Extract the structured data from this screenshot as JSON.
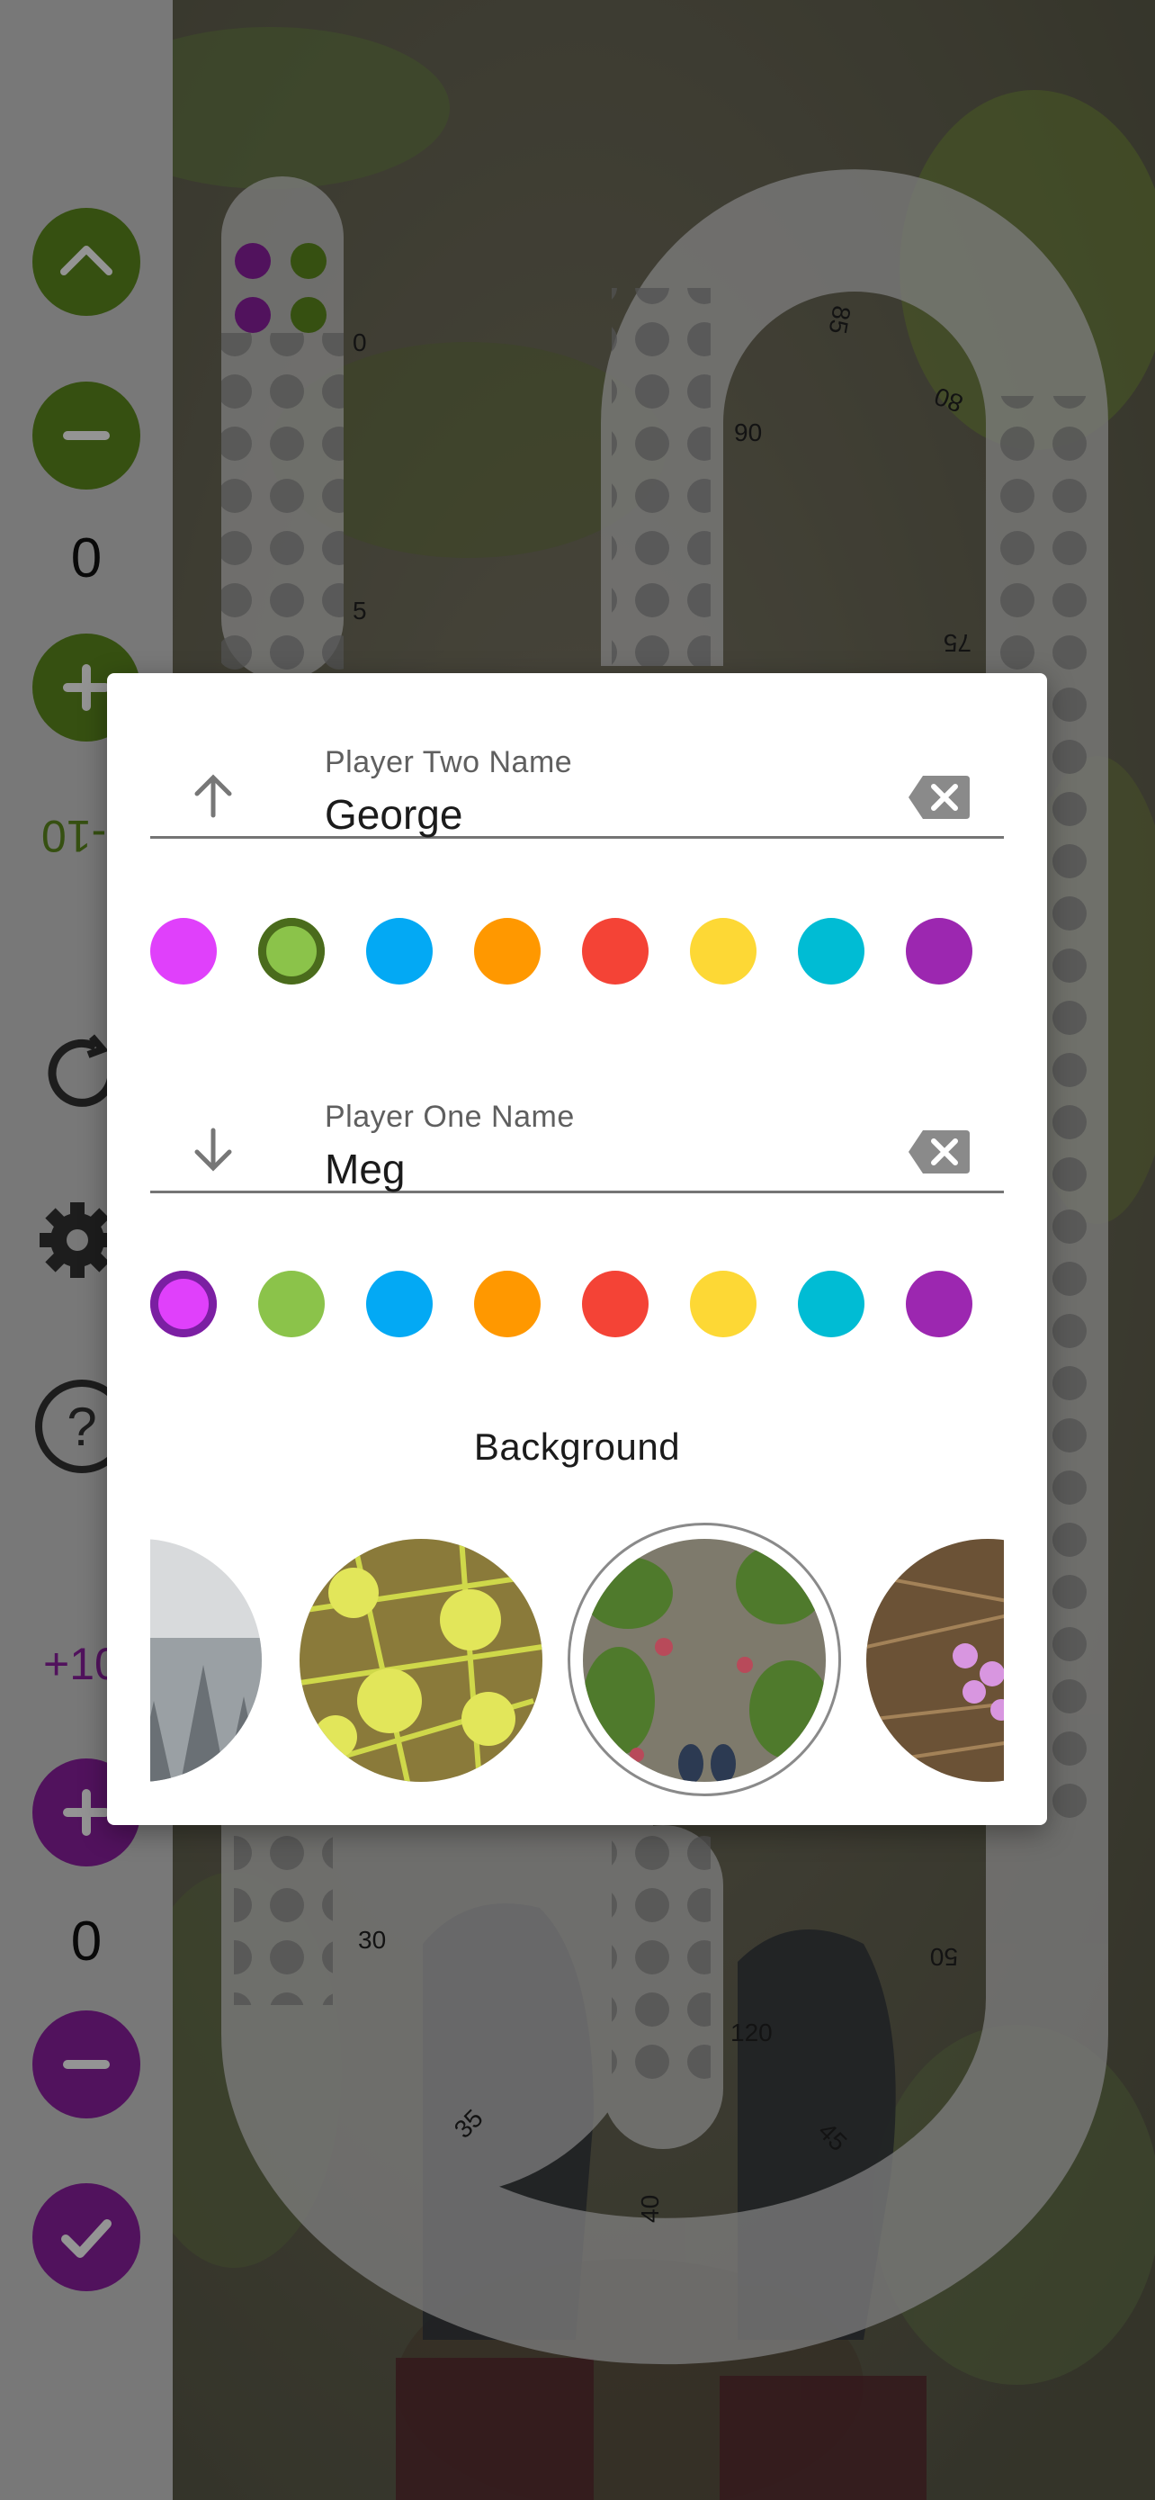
{
  "colors": {
    "player_two": "#5d8b1e",
    "player_one": "#8c1fa1",
    "palette": [
      "#e040fb",
      "#8bc34a",
      "#03a9f4",
      "#ff9800",
      "#f44336",
      "#fdd835",
      "#00bcd4",
      "#9c27b0"
    ]
  },
  "rail": {
    "top_score": "0",
    "top_step": "-10",
    "bottom_step": "+10",
    "bottom_score": "0"
  },
  "board": {
    "markers": [
      "0",
      "5",
      "30",
      "35",
      "40",
      "45",
      "50",
      "75",
      "80",
      "85",
      "90",
      "120"
    ]
  },
  "dialog": {
    "player_two": {
      "label": "Player Two Name",
      "value": "George",
      "arrow_icon": "arrow-up-icon",
      "selected_color_index": 1
    },
    "player_one": {
      "label": "Player One Name",
      "value": "Meg",
      "arrow_icon": "arrow-down-icon",
      "selected_color_index": 0
    },
    "background_title": "Background",
    "backgrounds": [
      "snowy-forest",
      "larch-branches",
      "forest-floor",
      "pink-flowers"
    ],
    "selected_background_index": 2
  }
}
